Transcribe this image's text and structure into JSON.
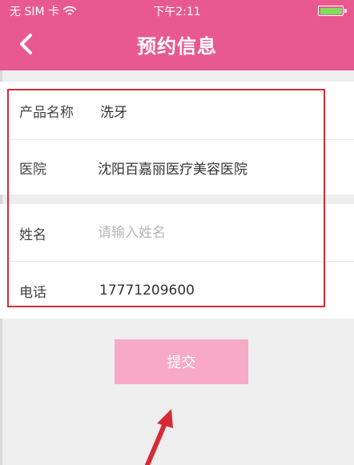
{
  "status_bar": {
    "carrier": "无 SIM 卡",
    "time": "下午2:11"
  },
  "nav": {
    "title": "预约信息"
  },
  "info": {
    "product_label": "产品名称",
    "product_value": "洗牙",
    "hospital_label": "医院",
    "hospital_value": "沈阳百嘉丽医疗美容医院"
  },
  "form": {
    "name_label": "姓名",
    "name_placeholder": "请输入姓名",
    "name_value": "",
    "phone_label": "电话",
    "phone_value": "17771209600"
  },
  "submit_label": "提交",
  "colors": {
    "header": "#e85a8f",
    "submit_button": "#f7a9c6",
    "highlight": "#d62b35",
    "arrow": "#d62b35"
  }
}
